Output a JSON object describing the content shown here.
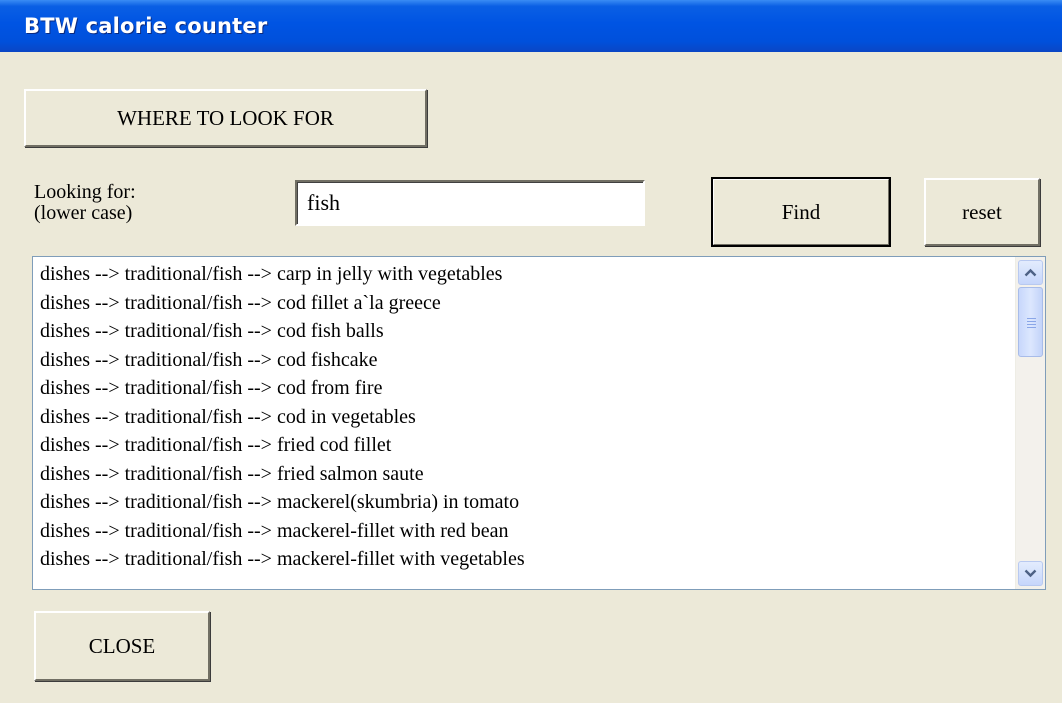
{
  "window": {
    "title": "BTW calorie counter"
  },
  "buttons": {
    "where": "WHERE TO LOOK FOR",
    "find": "Find",
    "reset": "reset",
    "close": "CLOSE"
  },
  "search": {
    "label_line1": "Looking for:",
    "label_line2": "(lower case)",
    "value": "fish"
  },
  "results": [
    "dishes --> traditional/fish --> carp in jelly with vegetables",
    "dishes --> traditional/fish --> cod fillet a`la greece",
    "dishes --> traditional/fish --> cod fish balls",
    "dishes --> traditional/fish --> cod fishcake",
    "dishes --> traditional/fish --> cod from fire",
    "dishes --> traditional/fish --> cod in vegetables",
    "dishes --> traditional/fish --> fried cod fillet",
    "dishes --> traditional/fish --> fried salmon saute",
    "dishes --> traditional/fish --> mackerel(skumbria) in tomato",
    "dishes --> traditional/fish --> mackerel-fillet with red bean",
    "dishes --> traditional/fish --> mackerel-fillet with vegetables"
  ],
  "colors": {
    "titlebar": "#0054e3",
    "face": "#ece9d8",
    "scroll_accent": "#4d6185"
  },
  "icons": {
    "scroll_up": "chevron-up-icon",
    "scroll_down": "chevron-down-icon"
  }
}
